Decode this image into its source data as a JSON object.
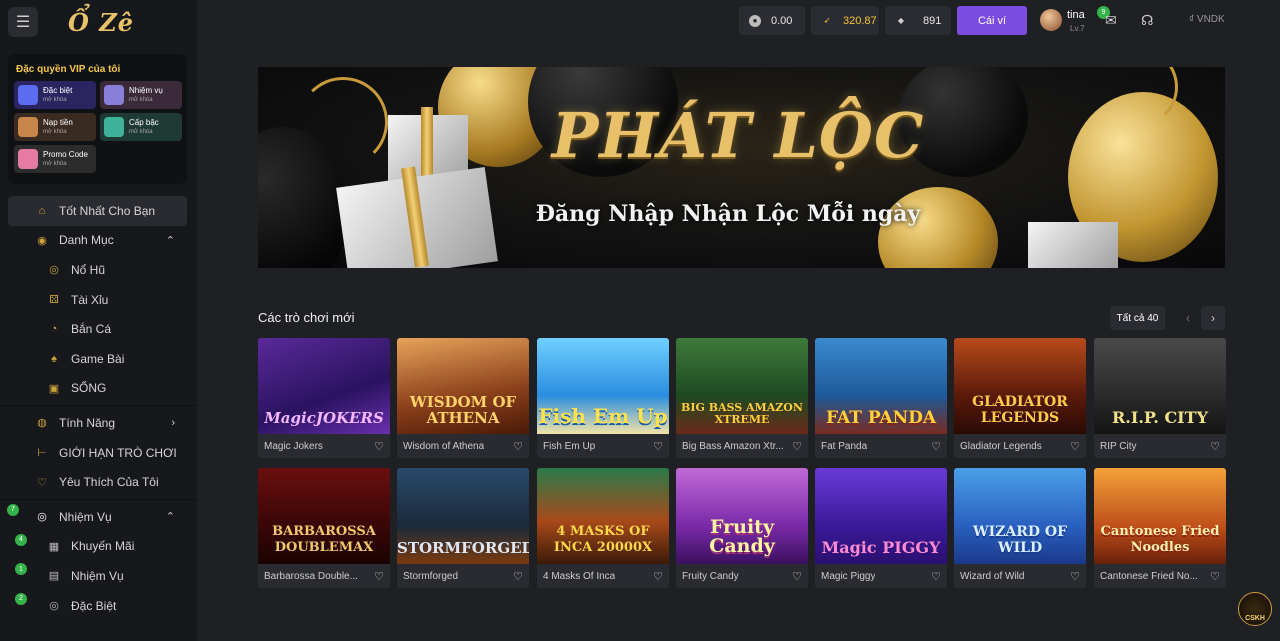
{
  "brand": {
    "logo": "Ổ Zê"
  },
  "sidebar": {
    "vip_title": "Đặc quyền VIP của tôi",
    "vip_cards": [
      {
        "label": "Đặc biệt",
        "sub": "mở khóa"
      },
      {
        "label": "Nhiệm vụ",
        "sub": "mở khóa"
      },
      {
        "label": "Nạp tiền",
        "sub": "mở khóa"
      },
      {
        "label": "Cấp bậc",
        "sub": "mở khóa"
      },
      {
        "label": "Promo Code",
        "sub": "mở khóa"
      }
    ],
    "nav": {
      "best": "Tốt Nhất Cho Bạn",
      "category": "Danh Mục",
      "no_hu": "Nổ Hũ",
      "tai_xiu": "Tài Xỉu",
      "ban_ca": "Bắn Cá",
      "game_bai": "Game Bài",
      "song": "SỐNG",
      "tinh_nang": "Tính Năng",
      "gioi_han": "GIỚI HẠN TRÒ CHƠI",
      "yeu_thich": "Yêu Thích Của Tôi",
      "nhiem_vu": "Nhiệm Vụ",
      "nhiem_vu_badge": "7",
      "khuyen_mai": "Khuyến Mãi",
      "khuyen_mai_badge": "4",
      "nhiem_vu_sub": "Nhiệm Vụ",
      "nhiem_vu_sub_badge": "1",
      "dac_biet": "Đặc Biệt",
      "dac_biet_badge": "2"
    }
  },
  "header": {
    "balance_1": "0.00",
    "balance_2": "320.87",
    "balance_3": "891",
    "wallet_button": "Cái ví",
    "username": "tina",
    "level": "Lv.7",
    "mail_badge": "9",
    "currency": "₫ VNDK"
  },
  "banner": {
    "title": "PHÁT LỘC",
    "subtitle": "Đăng Nhập Nhận Lộc Mỗi ngày"
  },
  "games": {
    "section_title": "Các trò chơi mới",
    "all_label": "Tất cả 40",
    "row1": [
      {
        "name": "Magic Jokers",
        "art": "MagicJOKERS"
      },
      {
        "name": "Wisdom of Athena",
        "art": "WISDOM OF ATHENA"
      },
      {
        "name": "Fish Em Up",
        "art": "Fish Em Up"
      },
      {
        "name": "Big Bass Amazon Xtr...",
        "art": "BIG BASS AMAZON XTREME"
      },
      {
        "name": "Fat Panda",
        "art": "FAT PANDA"
      },
      {
        "name": "Gladiator Legends",
        "art": "GLADIATOR LEGENDS"
      },
      {
        "name": "RIP City",
        "art": "R.I.P. CITY"
      }
    ],
    "row2": [
      {
        "name": "Barbarossa Double...",
        "art": "BARBAROSSA DOUBLEMAX"
      },
      {
        "name": "Stormforged",
        "art": "STORMFORGED"
      },
      {
        "name": "4 Masks Of Inca",
        "art": "4 MASKS OF INCA 20000X"
      },
      {
        "name": "Fruity Candy",
        "art": "Fruity Candy"
      },
      {
        "name": "Magic Piggy",
        "art": "Magic PIGGY"
      },
      {
        "name": "Wizard of Wild",
        "art": "WIZARD OF WILD"
      },
      {
        "name": "Cantonese Fried No...",
        "art": "Cantonese Fried Noodles"
      }
    ]
  },
  "support": {
    "label": "CSKH"
  }
}
